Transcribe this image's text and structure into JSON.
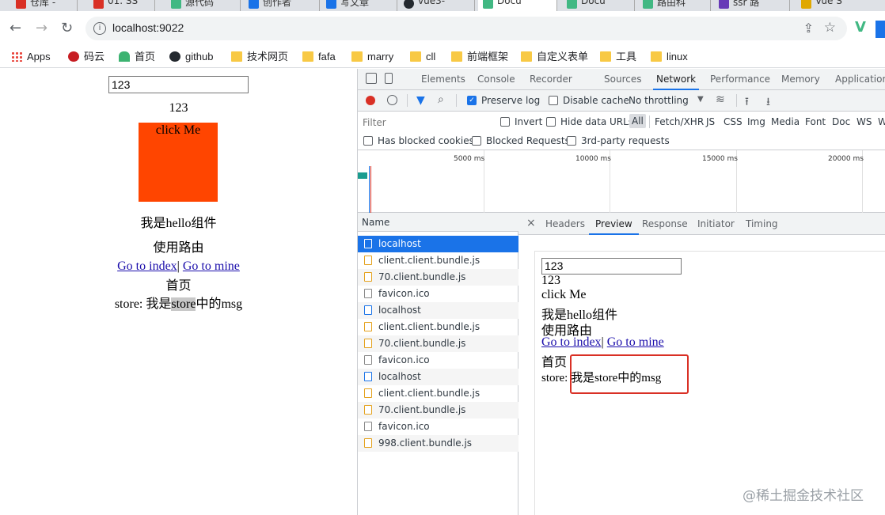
{
  "tabs": [
    {
      "label": "仓库 -",
      "color": "#d93025"
    },
    {
      "label": "01. SS",
      "color": "#d93025"
    },
    {
      "label": "源代码",
      "color": "#41b883"
    },
    {
      "label": "创作者",
      "color": "#1a73e8"
    },
    {
      "label": "写文章",
      "color": "#1a73e8"
    },
    {
      "label": "vue3-",
      "color": "#24292f"
    },
    {
      "label": "Docu",
      "color": "#41b883"
    },
    {
      "label": "Docu",
      "color": "#41b883"
    },
    {
      "label": "路由科",
      "color": "#41b883"
    },
    {
      "label": "ssr 路",
      "color": "#673ab7"
    },
    {
      "label": "Vue S",
      "color": "#e0a800"
    }
  ],
  "address_bar": {
    "url": "localhost:9022"
  },
  "bookmarks": [
    {
      "label": "Apps",
      "icon": "apps-grid-icon"
    },
    {
      "label": "码云",
      "icon": "gitee-icon"
    },
    {
      "label": "首页",
      "icon": "juejin-icon"
    },
    {
      "label": "github",
      "icon": "github-icon"
    },
    {
      "label": "技术网页",
      "icon": "folder-icon"
    },
    {
      "label": "fafa",
      "icon": "folder-icon"
    },
    {
      "label": "marry",
      "icon": "folder-icon"
    },
    {
      "label": "cll",
      "icon": "folder-icon"
    },
    {
      "label": "前端框架",
      "icon": "folder-icon"
    },
    {
      "label": "自定义表单",
      "icon": "folder-icon"
    },
    {
      "label": "工具",
      "icon": "folder-icon"
    },
    {
      "label": "linux",
      "icon": "folder-icon"
    }
  ],
  "page": {
    "input_value": "123",
    "echo": "123",
    "button_label": "click Me",
    "hello": "我是hello组件",
    "router": "使用路由",
    "link_index": "Go to index",
    "link_sep": "|",
    "link_mine": "Go to mine",
    "home": "首页",
    "store_prefix": "store: 我是",
    "store_hl": "store",
    "store_suffix": "中的msg"
  },
  "devtools": {
    "tabs": [
      "Elements",
      "Console",
      "Recorder",
      "Sources",
      "Network",
      "Performance",
      "Memory",
      "Application"
    ],
    "active_tab": "Network",
    "toolbar": {
      "preserve_log": "Preserve log",
      "disable_cache": "Disable cache",
      "throttling": "No throttling"
    },
    "filter": {
      "placeholder": "Filter",
      "invert": "Invert",
      "hide_data_urls": "Hide data URLs",
      "types": [
        "All",
        "Fetch/XHR",
        "JS",
        "CSS",
        "Img",
        "Media",
        "Font",
        "Doc",
        "WS",
        "W"
      ],
      "blocked_cookies": "Has blocked cookies",
      "blocked_requests": "Blocked Requests",
      "third_party": "3rd-party requests"
    },
    "timeline_labels": [
      "5000 ms",
      "10000 ms",
      "15000 ms",
      "20000 ms"
    ],
    "name_header": "Name",
    "requests": [
      {
        "name": "localhost",
        "type": "doc",
        "selected": true
      },
      {
        "name": "client.client.bundle.js",
        "type": "js"
      },
      {
        "name": "70.client.bundle.js",
        "type": "js"
      },
      {
        "name": "favicon.ico",
        "type": "other"
      },
      {
        "name": "localhost",
        "type": "doc"
      },
      {
        "name": "client.client.bundle.js",
        "type": "js"
      },
      {
        "name": "70.client.bundle.js",
        "type": "js"
      },
      {
        "name": "favicon.ico",
        "type": "other"
      },
      {
        "name": "localhost",
        "type": "doc"
      },
      {
        "name": "client.client.bundle.js",
        "type": "js"
      },
      {
        "name": "70.client.bundle.js",
        "type": "js"
      },
      {
        "name": "favicon.ico",
        "type": "other"
      },
      {
        "name": "998.client.bundle.js",
        "type": "js"
      }
    ],
    "detail_tabs": [
      "Headers",
      "Preview",
      "Response",
      "Initiator",
      "Timing"
    ],
    "active_detail_tab": "Preview",
    "preview": {
      "input_value": "123",
      "echo": "123",
      "button_label": "click Me",
      "hello": "我是hello组件",
      "router": "使用路由",
      "link_index": "Go to index",
      "link_sep": "|",
      "link_mine": "Go to mine",
      "home": "首页",
      "store_prefix": "store: ",
      "store_msg": "我是store中的msg"
    }
  },
  "watermark": "@稀土掘金技术社区",
  "colors": {
    "accent": "#1a73e8",
    "red_box": "#ff4500",
    "highlight_frame": "#d93025"
  }
}
